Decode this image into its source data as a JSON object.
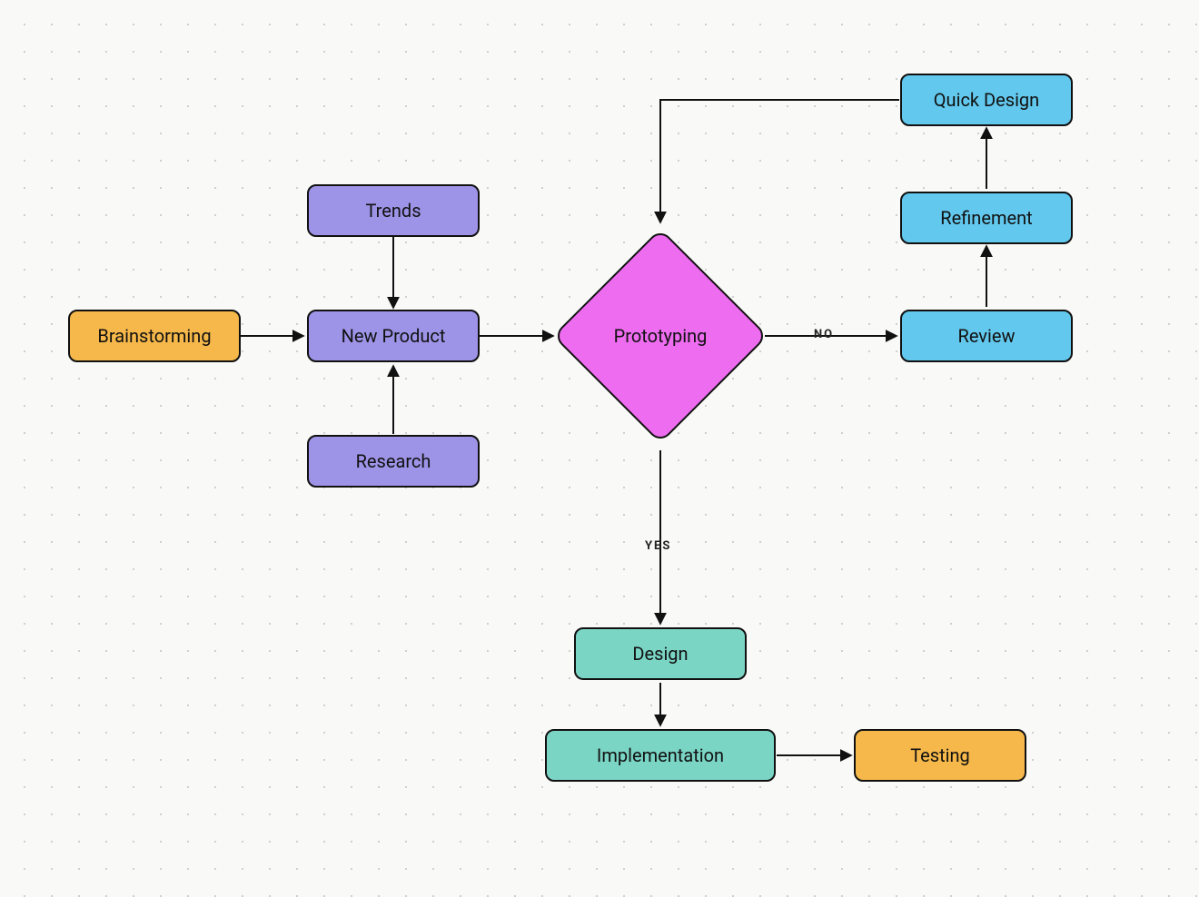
{
  "colors": {
    "orange": "#f6b84a",
    "purple": "#9d94e8",
    "magenta": "#ee6cf0",
    "teal": "#7ad5c5",
    "blue": "#62c8ed"
  },
  "nodes": {
    "brainstorming": "Brainstorming",
    "trends": "Trends",
    "new_product": "New Product",
    "research": "Research",
    "prototyping": "Prototyping",
    "design": "Design",
    "implementation": "Implementation",
    "testing": "Testing",
    "review": "Review",
    "refinement": "Refinement",
    "quick_design": "Quick Design"
  },
  "labels": {
    "yes": "YES",
    "no": "NO"
  }
}
